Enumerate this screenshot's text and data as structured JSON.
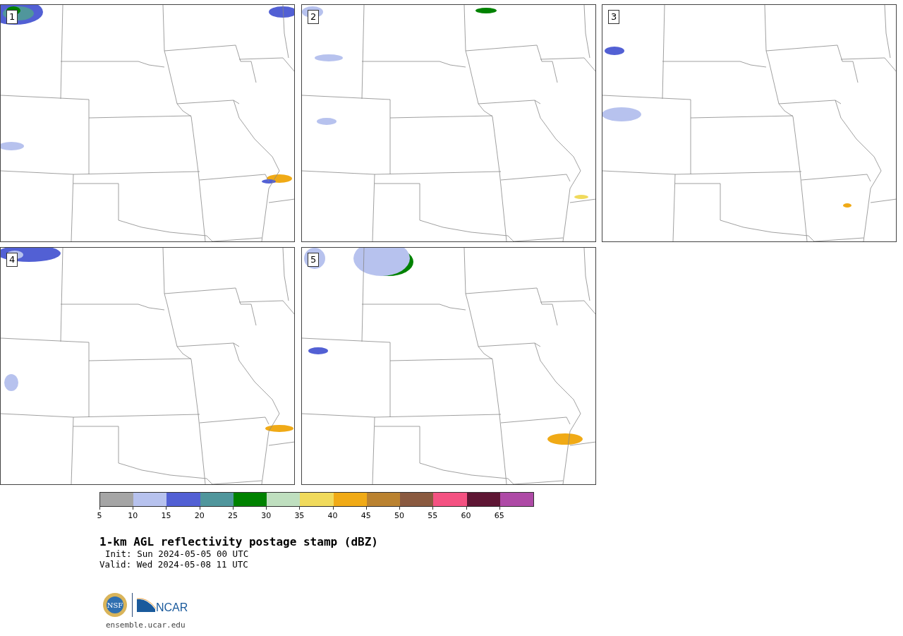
{
  "panels": [
    {
      "label": "1"
    },
    {
      "label": "2"
    },
    {
      "label": "3"
    },
    {
      "label": "4"
    },
    {
      "label": "5"
    }
  ],
  "colorbar": {
    "segments": [
      {
        "color": "#a5a5a5"
      },
      {
        "color": "#b7c2ee"
      },
      {
        "color": "#5260d4"
      },
      {
        "color": "#50969c"
      },
      {
        "color": "#008200"
      },
      {
        "color": "#bfdfbf"
      },
      {
        "color": "#f0da5c"
      },
      {
        "color": "#f0aa16"
      },
      {
        "color": "#ba8230"
      },
      {
        "color": "#8a5a40"
      },
      {
        "color": "#f45282"
      },
      {
        "color": "#5e1634"
      },
      {
        "color": "#ae4aa6"
      }
    ],
    "ticks": [
      "5",
      "10",
      "15",
      "20",
      "25",
      "30",
      "35",
      "40",
      "45",
      "50",
      "55",
      "60",
      "65"
    ]
  },
  "title": "1-km AGL reflectivity postage stamp (dBZ)",
  "init": "Init: Sun 2024-05-05 00 UTC",
  "valid": "Valid: Wed 2024-05-08 11 UTC",
  "logo": {
    "nsf": "NSF",
    "ncar": "NCAR"
  },
  "site": "ensemble.ucar.edu"
}
